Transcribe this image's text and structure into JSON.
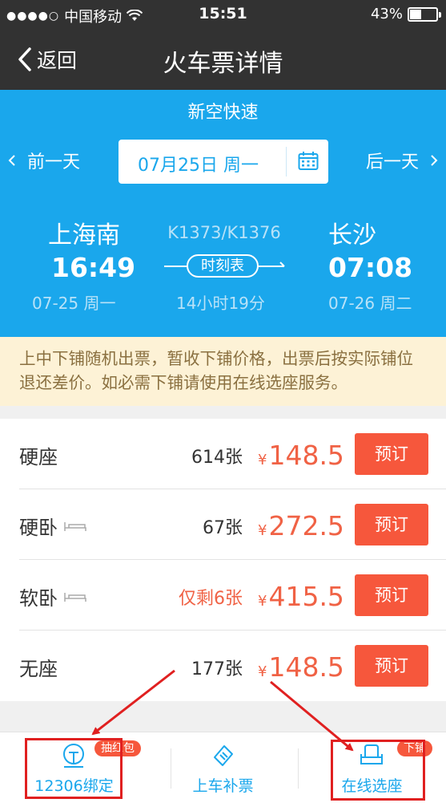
{
  "status_bar": {
    "carrier": "中国移动",
    "time": "15:51",
    "battery_percent": "43%",
    "battery_level": 0.43
  },
  "nav": {
    "back_label": "返回",
    "title": "火车票详情"
  },
  "train": {
    "type": "新空快速",
    "prev_day": "前一天",
    "next_day": "后一天",
    "date": "07月25日 周一",
    "from_station": "上海南",
    "to_station": "长沙",
    "train_no": "K1373/K1376",
    "dep_time": "16:49",
    "arr_time": "07:08",
    "schedule_label": "时刻表",
    "dep_date": "07-25 周一",
    "arr_date": "07-26 周二",
    "duration": "14小时19分"
  },
  "notice": "上中下铺随机出票，暂收下铺价格，出票后按实际铺位退还差价。如必需下铺请使用在线选座服务。",
  "seats": [
    {
      "name": "硬座",
      "count": "614张",
      "currency": "¥",
      "price": "148.5",
      "button": "预订"
    },
    {
      "name": "硬卧",
      "count": "67张",
      "currency": "¥",
      "price": "272.5",
      "button": "预订"
    },
    {
      "name": "软卧",
      "count": "仅剩6张",
      "currency": "¥",
      "price": "415.5",
      "button": "预订"
    },
    {
      "name": "无座",
      "count": "177张",
      "currency": "¥",
      "price": "148.5",
      "button": "预订"
    }
  ],
  "tabs": [
    {
      "label": "12306绑定",
      "badge": "抽红包",
      "icon": "train-icon"
    },
    {
      "label": "上车补票",
      "badge": "",
      "icon": "ticket-icon"
    },
    {
      "label": "在线选座",
      "badge": "下铺",
      "icon": "seat-icon"
    }
  ],
  "colors": {
    "accent": "#1aa7ec",
    "price": "#f06245",
    "button": "#f6573c",
    "annotation": "#e02020"
  }
}
